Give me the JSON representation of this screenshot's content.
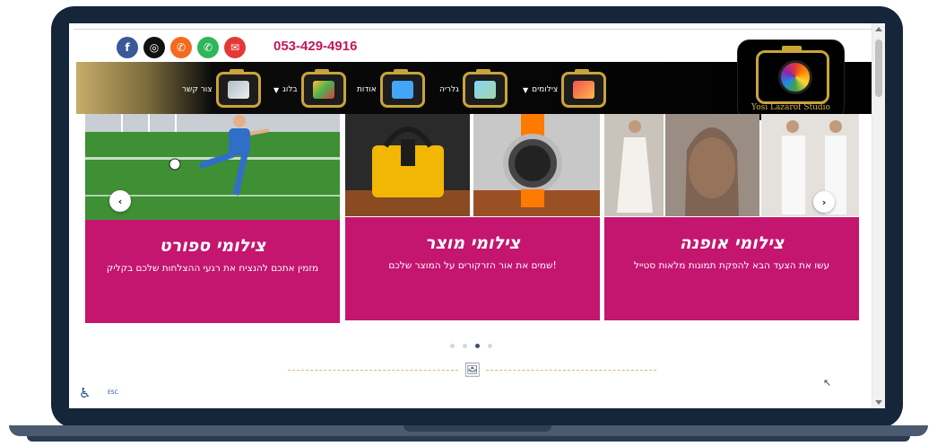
{
  "topbar": {
    "phone": "053-429-4916",
    "social": [
      {
        "name": "facebook-icon",
        "glyph": "f",
        "color": "#3b5998"
      },
      {
        "name": "instagram-icon",
        "glyph": "◎",
        "color": "#111111"
      },
      {
        "name": "phone-icon",
        "glyph": "✆",
        "color": "#f26b21"
      },
      {
        "name": "whatsapp-icon",
        "glyph": "✆",
        "color": "#2fb65a"
      },
      {
        "name": "email-icon",
        "glyph": "✉",
        "color": "#e53935"
      }
    ]
  },
  "nav": {
    "items": [
      {
        "label": "צילומים",
        "has_dropdown": true
      },
      {
        "label": "גלריה",
        "has_dropdown": false
      },
      {
        "label": "אודות",
        "has_dropdown": false
      },
      {
        "label": "בלוג",
        "has_dropdown": true
      },
      {
        "label": "צור קשר",
        "has_dropdown": false
      }
    ]
  },
  "logo": {
    "text": "Yosi Lazarof Studio"
  },
  "carousel": {
    "slides": [
      {
        "title": "צילומי ספורט",
        "text": "מזמין אתכם להנציח את רגעי ההצלחות שלכם בקליק"
      },
      {
        "title": "צילומי מוצר",
        "text": "שמים את אור הזרקורים על המוצר שלכם!"
      },
      {
        "title": "צילומי אופנה",
        "text": "עשו את הצעד הבא להפקת תמונות מלאות סטייל"
      }
    ],
    "dots_count": 4,
    "active_dot": 2
  },
  "accessibility": {
    "esc_label": "ESC"
  }
}
